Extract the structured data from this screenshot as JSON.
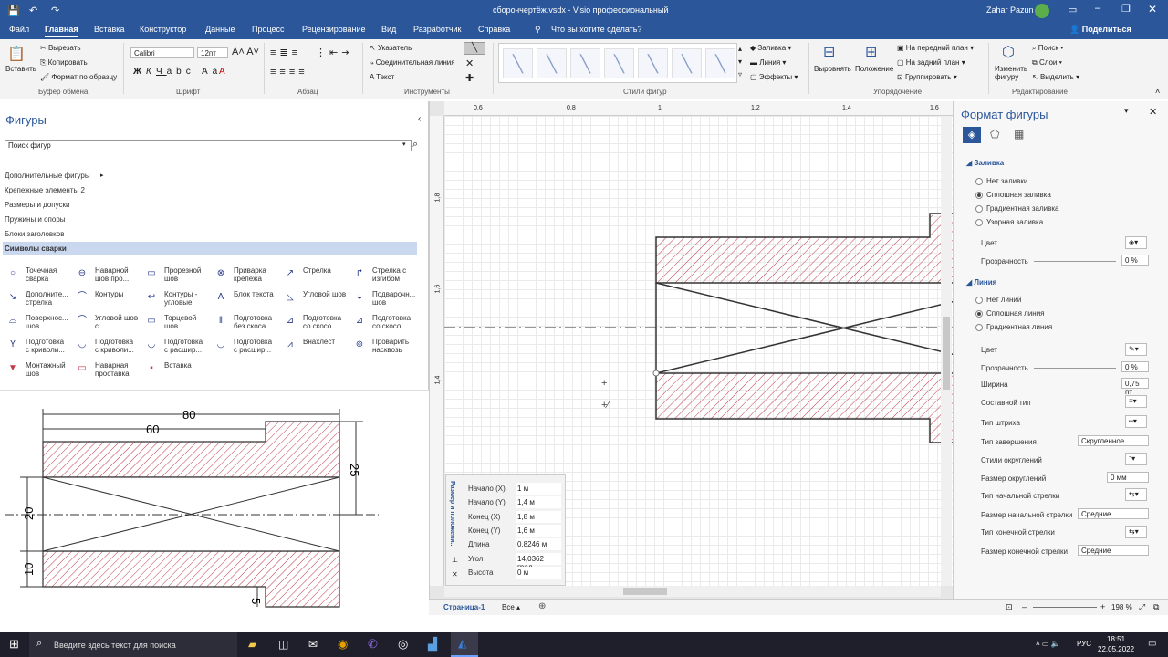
{
  "titlebar": {
    "file_title": "сбороччертёж.vsdx  -  Visio профессиональный",
    "user": "Zahar Pazun"
  },
  "tabs": [
    "Файл",
    "Главная",
    "Вставка",
    "Конструктор",
    "Данные",
    "Процесс",
    "Рецензирование",
    "Вид",
    "Разработчик",
    "Справка"
  ],
  "tell_me": "Что вы хотите сделать?",
  "share": "Поделиться",
  "ribbon": {
    "paste": "Вставить",
    "cut": "Вырезать",
    "copy": "Копировать",
    "format_painter": "Формат по образцу",
    "clipboard_group": "Буфер обмена",
    "font_name": "Calibri",
    "font_size": "12пт",
    "font_group": "Шрифт",
    "paragraph_group": "Абзац",
    "pointer": "Указатель",
    "connector": "Соединительная линия",
    "text": "Текст",
    "tools_group": "Инструменты",
    "shape_styles_group": "Стили фигур",
    "fill": "Заливка",
    "line": "Линия",
    "effects": "Эффекты",
    "align": "Выровнять",
    "position": "Положение",
    "bring_front": "На передний план",
    "send_back": "На задний план",
    "group": "Группировать",
    "arrange_group": "Упорядочение",
    "change_shape": "Изменить фигуру",
    "find": "Поиск",
    "layers": "Слои",
    "select": "Выделить",
    "editing_group": "Редактирование"
  },
  "shapes_panel": {
    "title": "Фигуры",
    "search_placeholder": "Поиск фигур",
    "stencils": [
      "Дополнительные фигуры",
      "Крепежные элементы 2",
      "Размеры и допуски",
      "Пружины и опоры",
      "Блоки заголовков",
      "Символы сварки"
    ],
    "items": [
      [
        "Точечная сварка",
        "Наварной шов про...",
        "Прорезной шов",
        "Приварка крепежа",
        "Стрелка",
        "Стрелка с изгибом"
      ],
      [
        "Дополните... стрелка",
        "Контуры",
        "Контуры - угловые",
        "Блок текста",
        "Угловой шов",
        "Подварочн... шов"
      ],
      [
        "Поверхнос... шов",
        "Угловой шов с ...",
        "Торцевой шов",
        "Подготовка без скоса ...",
        "Подготовка со скосо...",
        "Подготовка со скосо..."
      ],
      [
        "Подготовка с криволи...",
        "Подготовка с криволи...",
        "Подготовка с расшир...",
        "Подготовка с расшир...",
        "Внахлест",
        "Проварить насквозь"
      ],
      [
        "Монтажный шов",
        "Наварная проставка",
        "Вставка"
      ]
    ]
  },
  "drawing_dims": {
    "d80": "80",
    "d60": "60",
    "d25": "25",
    "d20": "20",
    "d10": "10",
    "d5": "5"
  },
  "ruler": {
    "h": [
      "0,6",
      "0,8",
      "1",
      "1,2",
      "1,4",
      "1,6"
    ],
    "v": [
      "1,8",
      "1,6",
      "1,4"
    ]
  },
  "size_panel": {
    "title": "Размер и положени...",
    "rows": [
      {
        "label": "Начало (X)",
        "value": "1 м"
      },
      {
        "label": "Начало (Y)",
        "value": "1,4 м"
      },
      {
        "label": "Конец (X)",
        "value": "1,8 м"
      },
      {
        "label": "Конец (Y)",
        "value": "1,6 м"
      },
      {
        "label": "Длина",
        "value": "0,8246 м"
      },
      {
        "label": "Угол",
        "value": "14,0362 град"
      },
      {
        "label": "Высота",
        "value": "0 м"
      }
    ]
  },
  "format_panel": {
    "title": "Формат фигуры",
    "fill_section": "Заливка",
    "fill_options": [
      "Нет заливки",
      "Сплошная заливка",
      "Градиентная заливка",
      "Узорная заливка"
    ],
    "color": "Цвет",
    "transparency": "Прозрачность",
    "transparency_value": "0 %",
    "line_section": "Линия",
    "line_options": [
      "Нет линий",
      "Сплошная линия",
      "Градиентная линия"
    ],
    "line_color": "Цвет",
    "line_transparency": "Прозрачность",
    "line_transparency_value": "0 %",
    "width": "Ширина",
    "width_value": "0,75 пт",
    "compound": "Составной тип",
    "dash": "Тип штриха",
    "cap": "Тип завершения",
    "cap_value": "Скругленное",
    "round_style": "Стили округлений",
    "round_size": "Размер округлений",
    "round_size_value": "0 мм",
    "begin_arrow": "Тип начальной стрелки",
    "begin_size": "Размер начальной стрелки",
    "begin_size_value": "Средние",
    "end_arrow": "Тип конечной стрелки",
    "end_size": "Размер конечной стрелки",
    "end_size_value": "Средние"
  },
  "status": {
    "page": "Страница-1",
    "all": "Все",
    "zoom": "198 %"
  },
  "taskbar": {
    "search": "Введите здесь текст для поиска",
    "lang": "РУС",
    "time": "18:51",
    "date": "22.05.2022"
  },
  "colors": {
    "accent": "#2b579a",
    "hatch": "#c0394b",
    "selected_stencil": "#c9d8ef"
  }
}
